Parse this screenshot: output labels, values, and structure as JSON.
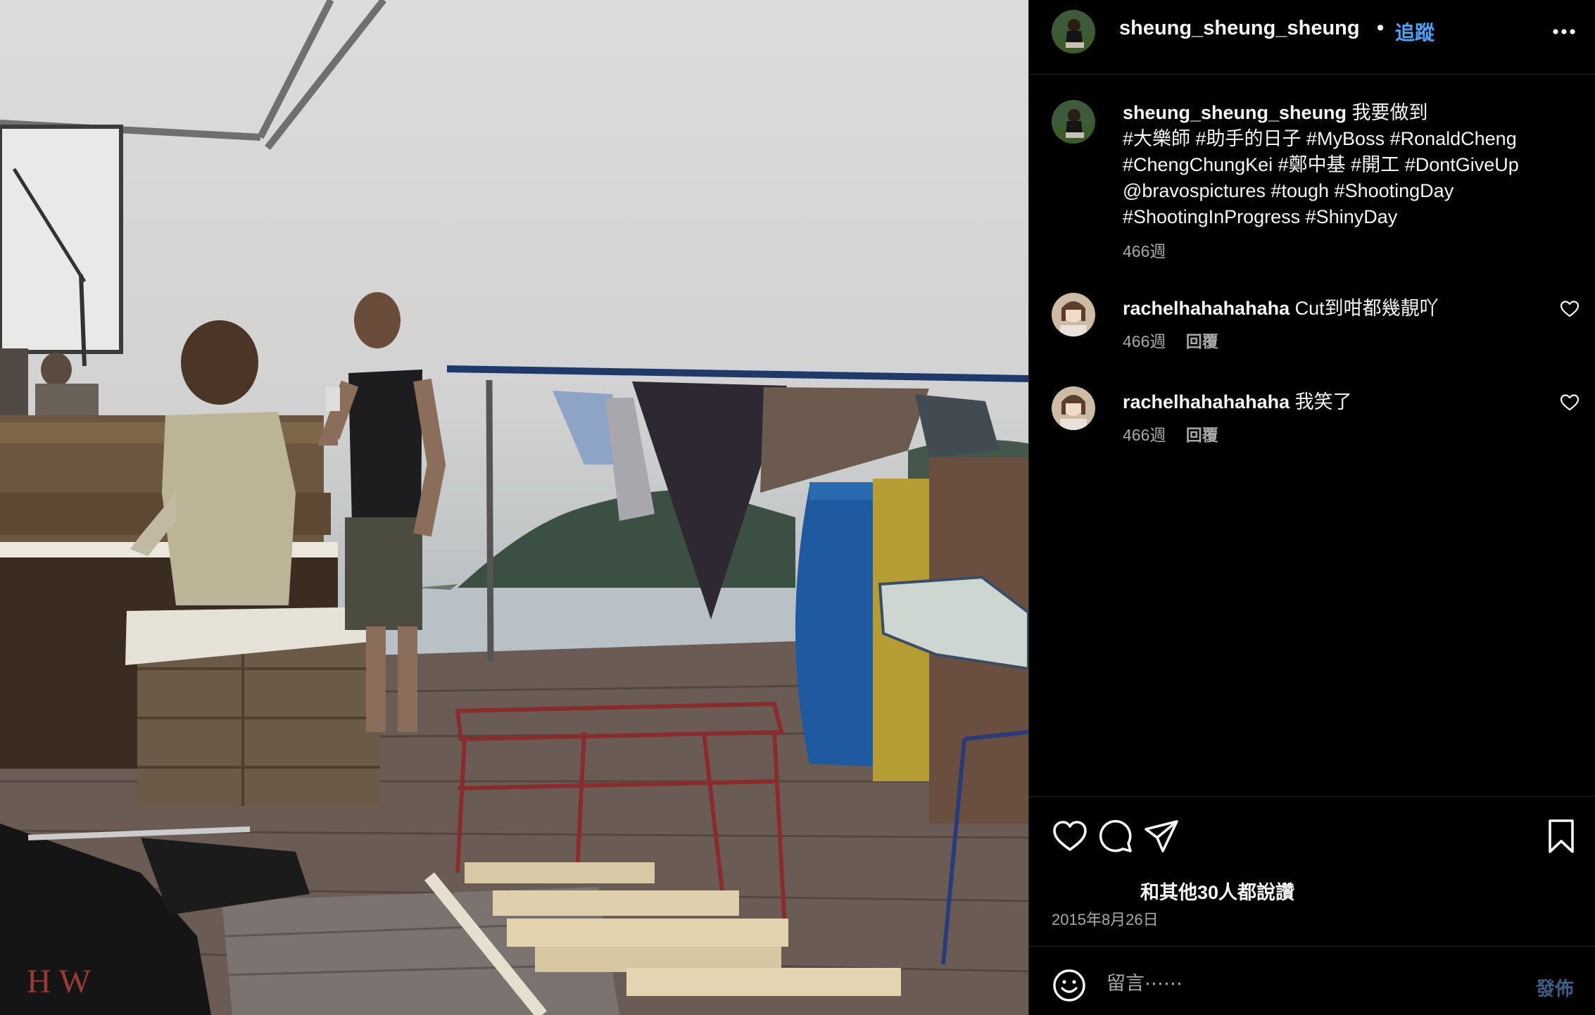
{
  "post": {
    "username": "sheung_sheung_sheung",
    "dot": "•",
    "follow_label": "追蹤",
    "more_icon": "more-horizontal-icon"
  },
  "caption": {
    "username": "sheung_sheung_sheung",
    "lines": [
      "我要做到",
      "#大樂師 #助手的日子 #MyBoss #RonaldCheng",
      "#ChengChungKei #鄭中基 #開工 #DontGiveUp",
      "@bravospictures #tough #ShootingDay",
      "#ShootingInProgress #ShinyDay"
    ],
    "time": "466週"
  },
  "comments": [
    {
      "username": "rachelhahahahaha",
      "text": "Cut到咁都幾靚吖",
      "time": "466週",
      "reply_label": "回覆"
    },
    {
      "username": "rachelhahahahaha",
      "text": "我笑了",
      "time": "466週",
      "reply_label": "回覆"
    }
  ],
  "actions": {
    "icons": [
      "heart-icon",
      "comment-icon",
      "share-icon",
      "bookmark-icon"
    ],
    "likes_text": "和其他30人都說讚",
    "date": "2015年8月26日"
  },
  "comment_input": {
    "placeholder": "留言⋯⋯",
    "post_label": "發佈",
    "emoji_icon": "emoji-icon"
  },
  "colors": {
    "background": "#000000",
    "text": "#f5f5f5",
    "secondary": "#a8a8a8",
    "link": "#4aa3f5",
    "post_disabled": "#3a5f82"
  }
}
